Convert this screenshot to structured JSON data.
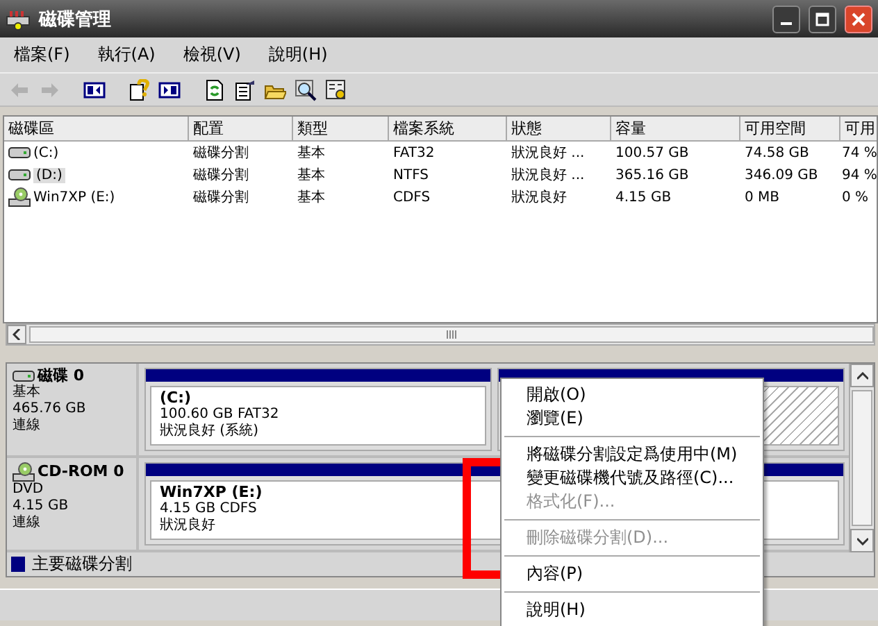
{
  "window": {
    "title": "磁碟管理"
  },
  "menu_bar": [
    "檔案(F)",
    "執行(A)",
    "檢視(V)",
    "說明(H)"
  ],
  "toolbar": [
    {
      "kind": "back",
      "disabled": true
    },
    {
      "kind": "forward",
      "disabled": true
    },
    {
      "kind": "pane-left"
    },
    {
      "kind": "help"
    },
    {
      "kind": "pane-right"
    },
    {
      "kind": "refresh"
    },
    {
      "kind": "properties"
    },
    {
      "kind": "folder"
    },
    {
      "kind": "search"
    },
    {
      "kind": "settings"
    }
  ],
  "table": {
    "columns": [
      "磁碟區",
      "配置",
      "類型",
      "檔案系統",
      "狀態",
      "容量",
      "可用空間",
      "可用"
    ],
    "rows": [
      {
        "kind": "disk",
        "selected": false,
        "cells": [
          "(C:)",
          "磁碟分割",
          "基本",
          "FAT32",
          "狀況良好 ...",
          "100.57 GB",
          "74.58 GB",
          "74 %"
        ]
      },
      {
        "kind": "disk",
        "selected": true,
        "cells": [
          "(D:)",
          "磁碟分割",
          "基本",
          "NTFS",
          "狀況良好 ...",
          "365.16 GB",
          "346.09 GB",
          "94 %"
        ]
      },
      {
        "kind": "cd",
        "selected": false,
        "cells": [
          "Win7XP (E:)",
          "磁碟分割",
          "基本",
          "CDFS",
          "狀況良好",
          "4.15 GB",
          "0 MB",
          "0 %"
        ]
      }
    ]
  },
  "disks": [
    {
      "kind": "disk",
      "name": "磁碟 0",
      "type": "基本",
      "size": "465.76 GB",
      "status": "連線",
      "partitions": [
        {
          "kind": "primary",
          "label": "(C:)",
          "detail": "100.60 GB FAT32",
          "status": "狀況良好 (系統)"
        },
        {
          "kind": "hatched"
        }
      ]
    },
    {
      "kind": "cd",
      "name": "CD-ROM 0",
      "type": "DVD",
      "size": "4.15 GB",
      "status": "連線",
      "partitions": [
        {
          "kind": "primary",
          "label": "Win7XP  (E:)",
          "detail": "4.15 GB CDFS",
          "status": "狀況良好"
        }
      ]
    }
  ],
  "legend": [
    {
      "label": "主要磁碟分割",
      "color": "#000080"
    }
  ],
  "context_menu": [
    {
      "kind": "item",
      "label": "開啟(O)",
      "disabled": false
    },
    {
      "kind": "item",
      "label": "瀏覽(E)",
      "disabled": false
    },
    {
      "kind": "separator"
    },
    {
      "kind": "item",
      "label": "將磁碟分割設定爲使用中(M)",
      "disabled": false
    },
    {
      "kind": "item",
      "label": "變更磁碟機代號及路徑(C)...",
      "disabled": false
    },
    {
      "kind": "item",
      "label": "格式化(F)...",
      "disabled": true
    },
    {
      "kind": "separator"
    },
    {
      "kind": "item",
      "label": "刪除磁碟分割(D)...",
      "disabled": true
    },
    {
      "kind": "separator"
    },
    {
      "kind": "item",
      "label": "內容(P)",
      "disabled": false
    },
    {
      "kind": "separator"
    },
    {
      "kind": "item",
      "label": "說明(H)",
      "disabled": false
    }
  ]
}
